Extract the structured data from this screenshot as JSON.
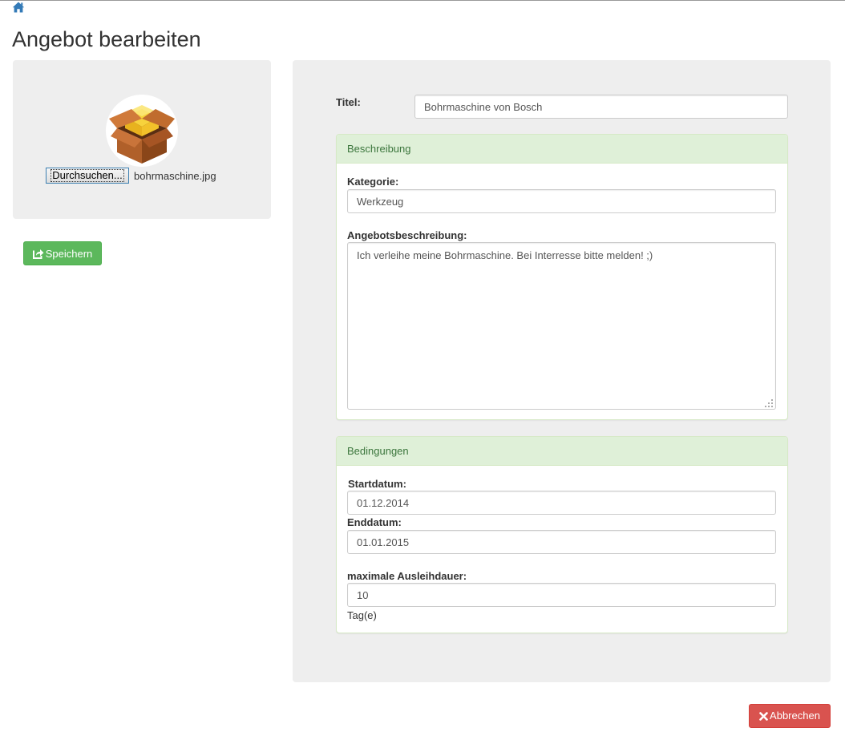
{
  "nav": {
    "home_icon": "home-icon"
  },
  "page": {
    "title": "Angebot bearbeiten"
  },
  "image_upload": {
    "image_icon": "package-box-icon",
    "browse_label": "Durchsuchen...",
    "file_name": "bohrmaschine.jpg"
  },
  "actions": {
    "save_label": "Speichern",
    "save_icon": "share-save-icon",
    "cancel_label": "Abbrechen",
    "cancel_icon": "close-x-icon"
  },
  "form": {
    "title_label": "Titel:",
    "title_value": "Bohrmaschine von Bosch",
    "description": {
      "heading": "Beschreibung",
      "category_label": "Kategorie:",
      "category_value": "Werkzeug",
      "text_label": "Angebotsbeschreibung:",
      "text_value": "Ich verleihe meine Bohrmaschine. Bei Interresse bitte melden! ;)"
    },
    "conditions": {
      "heading": "Bedingungen",
      "start_label": "Startdatum:",
      "start_value": "01.12.2014",
      "end_label": "Enddatum:",
      "end_value": "01.01.2015",
      "max_label": "maximale Ausleihdauer:",
      "max_value": "10",
      "max_unit": "Tag(e)"
    }
  },
  "colors": {
    "save": "#5cb85c",
    "cancel": "#d9534f",
    "panel_heading_bg": "#dff0d8",
    "panel_heading_text": "#3c763d",
    "home_icon": "#337ab7"
  }
}
